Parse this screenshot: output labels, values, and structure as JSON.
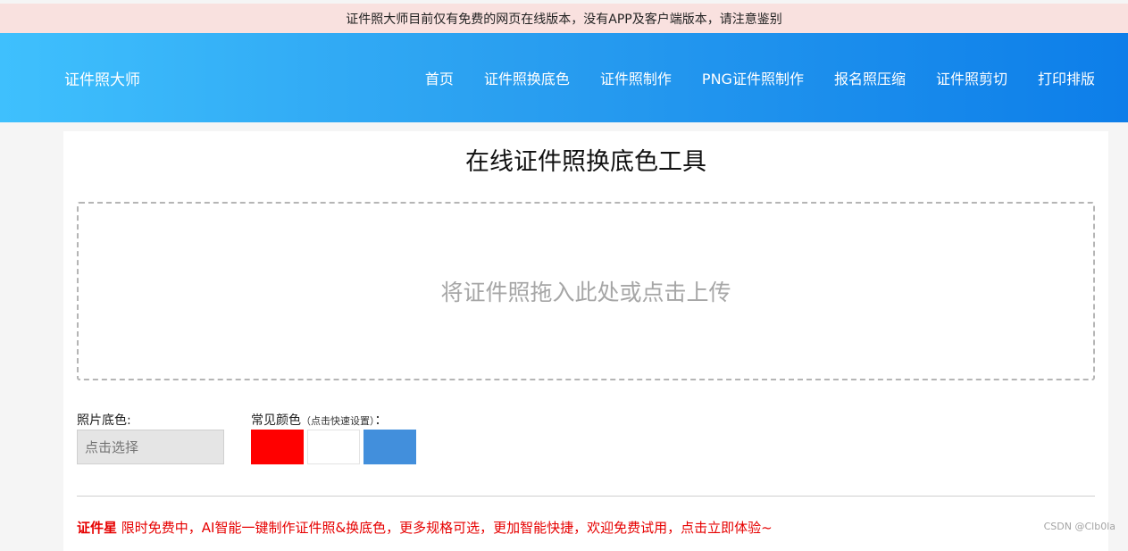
{
  "notice": {
    "text": "证件照大师目前仅有免费的网页在线版本，没有APP及客户端版本，请注意鉴别"
  },
  "header": {
    "logo": "证件照大师",
    "nav": [
      {
        "label": "首页"
      },
      {
        "label": "证件照换底色"
      },
      {
        "label": "证件照制作"
      },
      {
        "label": "PNG证件照制作"
      },
      {
        "label": "报名照压缩"
      },
      {
        "label": "证件照剪切"
      },
      {
        "label": "打印排版"
      }
    ]
  },
  "main": {
    "title": "在线证件照换底色工具",
    "upload_text": "将证件照拖入此处或点击上传",
    "bg_color_label": "照片底色:",
    "bg_color_placeholder": "点击选择",
    "common_colors_label": "常见颜色",
    "common_colors_hint": "（点击快速设置）",
    "common_colors_colon": "：",
    "swatches": {
      "red": "#ff0000",
      "white": "#ffffff",
      "blue": "#428fdc"
    },
    "promo_brand": "证件星",
    "promo_text": " 限时免费中，AI智能一键制作证件照&换底色，更多规格可选，更加智能快捷，欢迎免费试用，点击立即体验~",
    "promo_color": "#e60000"
  },
  "watermark": "CSDN @Clb0la"
}
